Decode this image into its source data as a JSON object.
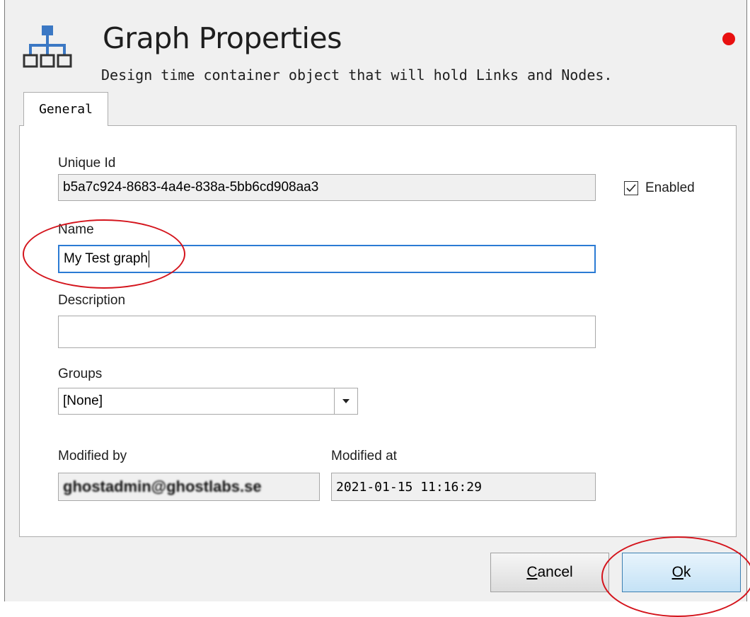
{
  "header": {
    "title": "Graph Properties",
    "subtitle": "Design time container object that will hold Links and Nodes.",
    "icon": "network-hierarchy-icon",
    "status_dot_color": "#e81010"
  },
  "tabs": [
    {
      "label": "General",
      "active": true
    }
  ],
  "form": {
    "unique_id": {
      "label": "Unique Id",
      "value": "b5a7c924-8683-4a4e-838a-5bb6cd908aa3"
    },
    "enabled": {
      "label": "Enabled",
      "checked": true
    },
    "name": {
      "label": "Name",
      "value": "My Test graph"
    },
    "description": {
      "label": "Description",
      "value": ""
    },
    "groups": {
      "label": "Groups",
      "selected": "[None]"
    },
    "modified_by": {
      "label": "Modified by",
      "value": "ghostadmin@ghostlabs.se"
    },
    "modified_at": {
      "label": "Modified at",
      "value": "2021-01-15 11:16:29"
    }
  },
  "buttons": {
    "cancel": "Cancel",
    "ok": "Ok"
  },
  "colors": {
    "accent": "#2b7bd4",
    "annotation": "#d4141c"
  }
}
